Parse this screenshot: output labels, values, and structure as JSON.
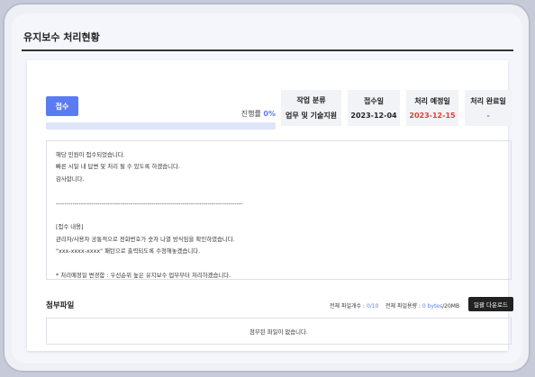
{
  "page": {
    "title": "유지보수 처리현황"
  },
  "status": {
    "label": "접수"
  },
  "progress": {
    "prefix": "진행률 ",
    "value": "0%",
    "fraction": 0
  },
  "info": [
    {
      "label": "작업 분류",
      "value": "업무 및 기술지원",
      "color": "default"
    },
    {
      "label": "접수일",
      "value": "2023-12-04",
      "color": "default"
    },
    {
      "label": "처리 예정일",
      "value": "2023-12-15",
      "color": "#e23b3b"
    },
    {
      "label": "처리 완료일",
      "value": "-",
      "color": "#5b7bf0"
    }
  ],
  "content_lines": [
    "해당 민원이 접수되었습니다.",
    "빠른 시일 내 답변 및 처리 될 수 있도록 하겠습니다.",
    "감사합니다.",
    "",
    "------------------------------------------------------------------------------------------",
    "",
    "[접수 내용]",
    "관리자/사용자 공통적으로 전화번호가 숫자 나열 방식임을 확인하였습니다.",
    "\"xxx-xxxx-xxxx\" 패턴으로 출력되도록 수정해놓겠습니다.",
    "",
    "* 처리예정일 변경함 : 우선순위 높은 유지보수 업무부터 처리하겠습니다."
  ],
  "attachments": {
    "title": "첨부파일",
    "count_label": "전체 파일개수 : ",
    "count_value": "0/10",
    "size_label": "전체 파일용량 : ",
    "size_value": "0 bytes",
    "size_max": "/20MB",
    "download_label": "일괄 다운로드",
    "empty_text": "첨부된 파일이 없습니다."
  }
}
